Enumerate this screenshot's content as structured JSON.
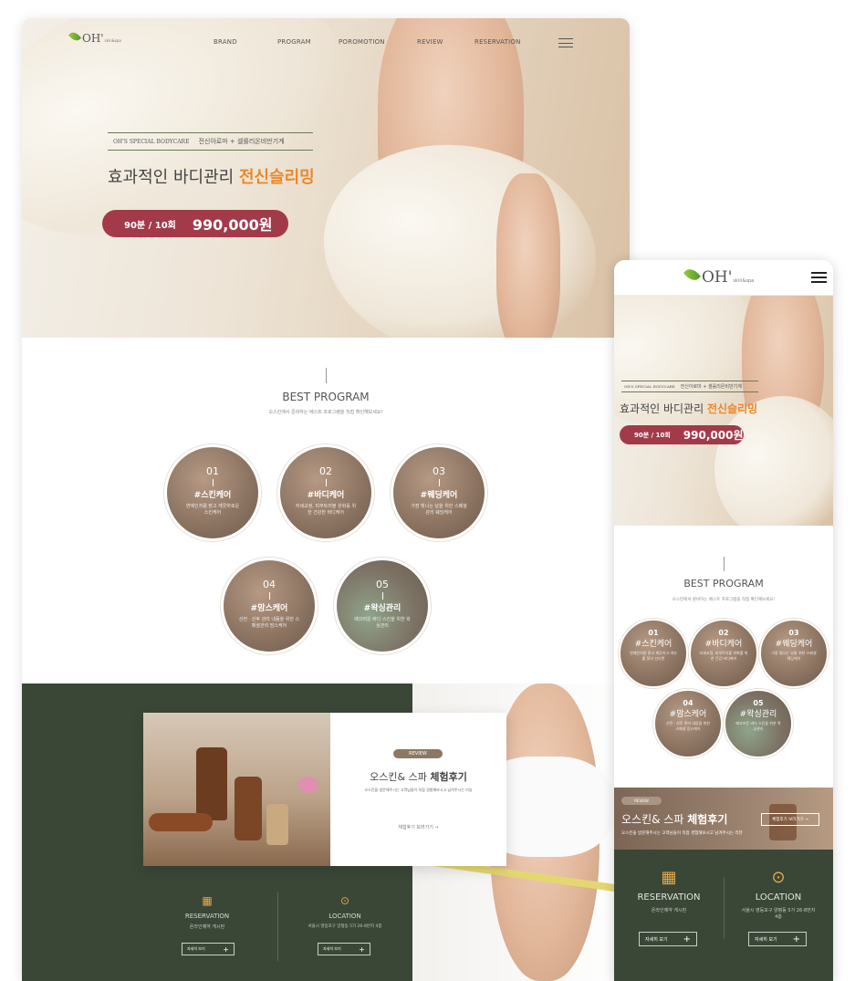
{
  "desktop": {
    "logo": {
      "text": "OH'",
      "sub": "skin&spa"
    },
    "nav": [
      "BRAND",
      "PROGRAM",
      "POROMOTION",
      "REVIEW",
      "RESERVATION"
    ],
    "hero": {
      "eyebrow_left": "OH'S SPECIAL BODYCARE",
      "eyebrow_right": "전신아로마 + 셀룰리온비만기계",
      "headline_plain": "효과적인 바디관리",
      "headline_accent": "전신슬리밍",
      "price_duration": "90분 / 10회",
      "price_value": "990,000원"
    },
    "best": {
      "title": "BEST PROGRAM",
      "subtitle": "오스킨에서 준비하는 베스트 프로그램을 직접 확인해보세요!",
      "items": [
        {
          "num": "01",
          "title": "#스킨케어",
          "desc": "연예인처럼 맑고 깨끗하로운 스킨케어"
        },
        {
          "num": "02",
          "title": "#바디케어",
          "desc": "자세교정, 피부트러블 완화를 위한 건강한 바디케어"
        },
        {
          "num": "03",
          "title": "#웨딩케어",
          "desc": "가장 빛나는 날을 위한 스페셜 관리 웨딩케어"
        },
        {
          "num": "04",
          "title": "#맘스케어",
          "desc": "산전 · 산후 관리 내몸을 위한 스페셜관리 맘스케어"
        },
        {
          "num": "05",
          "title": "#왁싱관리",
          "desc": "매끄러운 바디 스킨을 위한 왁싱관리"
        }
      ]
    },
    "review": {
      "tag": "REVIEW",
      "title_plain": "오스킨& 스파",
      "title_bold": "체험후기",
      "desc": "오스킨을 방문해주시는 고객님들이 직접 경험해보시고 남겨주시는 리뷰",
      "link": "체험후기 보러가기"
    },
    "reservation": {
      "title": "RESERVATION",
      "desc": "온라인예약 게시판",
      "btn": "자세히 보기"
    },
    "location": {
      "title": "LOCATION",
      "desc": "서울시 영등포구 양평동 5가 26-8번지 4층",
      "btn": "자세히 보기"
    }
  },
  "mobile": {
    "logo": {
      "text": "OH'",
      "sub": "skin&spa"
    },
    "hero": {
      "eyebrow_left": "OH'S SPECIAL BODYCARE",
      "eyebrow_right": "전신아로마 + 셀룰리온비만기계",
      "headline_plain": "효과적인 바디관리",
      "headline_accent": "전신슬리밍",
      "price_duration": "90분 / 10회",
      "price_value": "990,000원"
    },
    "best": {
      "title": "BEST PROGRAM",
      "subtitle": "오스킨에서 준비하는 베스트 프로그램을 직접 확인해보세요!",
      "items": [
        {
          "num": "01",
          "title": "#스킨케어",
          "desc": "연예인처럼 맑고 깨끗하고 여부를 찾아 선다면"
        },
        {
          "num": "02",
          "title": "#바디케어",
          "desc": "자세교정, 피부트러블 완화를 위한 건강 바디케어"
        },
        {
          "num": "03",
          "title": "#웨딩케어",
          "desc": "가장 빛나는 날을 위한 스페셜 웨딩케어"
        },
        {
          "num": "04",
          "title": "#맘스케어",
          "desc": "산전 · 산후 관리 내몸을 위한 스페셜 맘스케어"
        },
        {
          "num": "05",
          "title": "#왁싱관리",
          "desc": "매끄러운 바디 스킨을 위한 왁싱관리"
        }
      ]
    },
    "review": {
      "tag": "REVIEW",
      "title_plain": "오스킨& 스파",
      "title_bold": "체험후기",
      "desc": "오스킨을 방문해주시는 고객님들이 직접 경험해보시고 남겨주시는 리뷰",
      "link": "체험후기 보러가기 →"
    },
    "reservation": {
      "title": "RESERVATION",
      "desc": "온라인예약 게시판",
      "btn": "자세히 보기"
    },
    "location": {
      "title": "LOCATION",
      "desc": "서울시 영등포구 양평동 5가 26-8번지 4층",
      "btn": "자세히 보기"
    }
  },
  "colors": {
    "accent_orange": "#e8892b",
    "price_red": "#a23a4a",
    "dark_green": "#3a4737",
    "circle_brown": "#8a7260",
    "leaf_green": "#6aaf2c"
  }
}
